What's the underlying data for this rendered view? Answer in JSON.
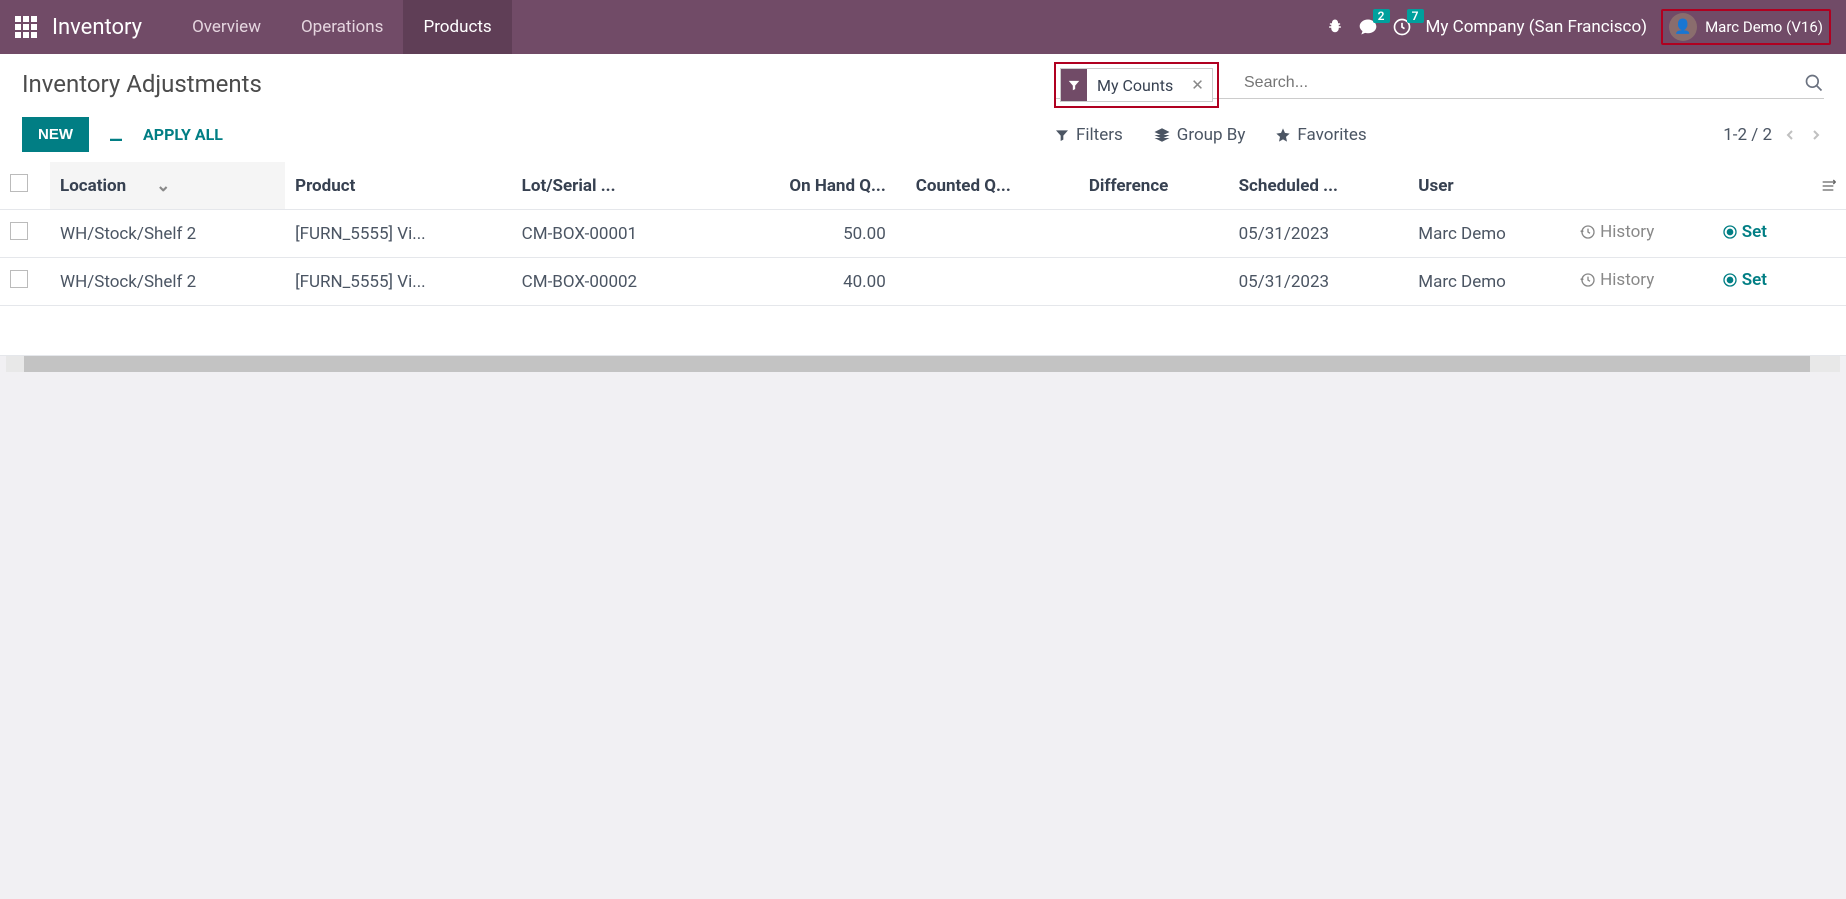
{
  "navbar": {
    "brand": "Inventory",
    "menu": [
      "Overview",
      "Operations",
      "Products"
    ],
    "active_menu": "Products",
    "messages_badge": "2",
    "activities_badge": "7",
    "company": "My Company (San Francisco)",
    "user": "Marc Demo (V16)"
  },
  "page": {
    "title": "Inventory Adjustments",
    "new_btn": "NEW",
    "apply_all": "APPLY ALL",
    "filters": "Filters",
    "group_by": "Group By",
    "favorites": "Favorites",
    "pager": "1-2 / 2"
  },
  "search": {
    "facet_label": "My Counts",
    "placeholder": "Search..."
  },
  "columns": {
    "location": "Location",
    "product": "Product",
    "lot": "Lot/Serial ...",
    "onhand": "On Hand Q...",
    "counted": "Counted Q...",
    "diff": "Difference",
    "sched": "Scheduled ...",
    "user": "User"
  },
  "rows": [
    {
      "location": "WH/Stock/Shelf 2",
      "product": "[FURN_5555] Vi...",
      "lot": "CM-BOX-00001",
      "onhand": "50.00",
      "counted": "",
      "diff": "",
      "sched": "05/31/2023",
      "user": "Marc Demo"
    },
    {
      "location": "WH/Stock/Shelf 2",
      "product": "[FURN_5555] Vi...",
      "lot": "CM-BOX-00002",
      "onhand": "40.00",
      "counted": "",
      "diff": "",
      "sched": "05/31/2023",
      "user": "Marc Demo"
    }
  ],
  "actions": {
    "history": "History",
    "set": "Set"
  }
}
